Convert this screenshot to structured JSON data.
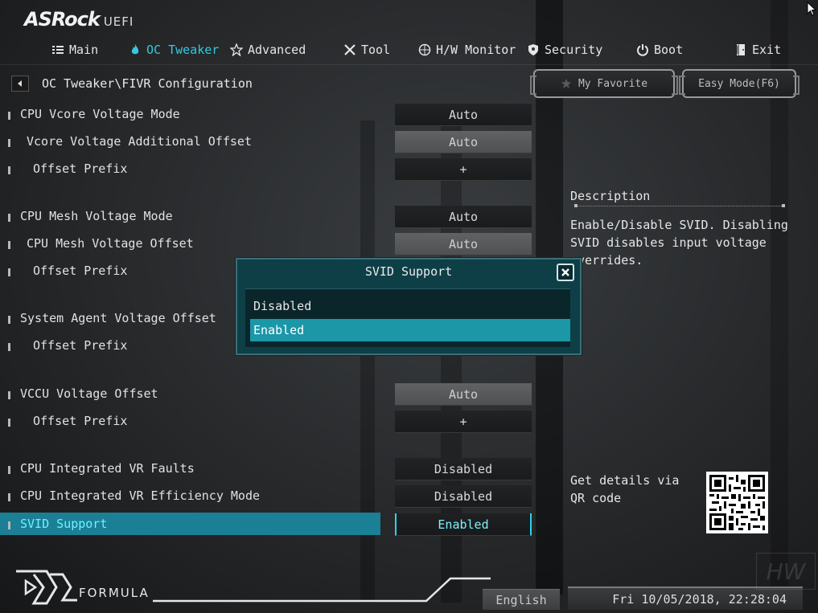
{
  "brand": {
    "name": "ASRock",
    "suffix": "UEFI"
  },
  "nav": {
    "items": [
      {
        "label": "Main",
        "icon": "list-icon",
        "active": false
      },
      {
        "label": "OC Tweaker",
        "icon": "flame-icon",
        "active": true
      },
      {
        "label": "Advanced",
        "icon": "star-icon",
        "active": false
      },
      {
        "label": "Tool",
        "icon": "tools-icon",
        "active": false
      },
      {
        "label": "H/W Monitor",
        "icon": "monitor-icon",
        "active": false
      },
      {
        "label": "Security",
        "icon": "shield-icon",
        "active": false
      },
      {
        "label": "Boot",
        "icon": "power-icon",
        "active": false
      },
      {
        "label": "Exit",
        "icon": "exit-icon",
        "active": false
      }
    ]
  },
  "breadcrumb": {
    "path": "OC Tweaker\\FIVR Configuration"
  },
  "buttons": {
    "favorite": "My Favorite",
    "easy_mode": "Easy Mode(F6)"
  },
  "settings": [
    {
      "label": "CPU Vcore Voltage Mode",
      "value": "Auto",
      "indent": 0,
      "style": "dark"
    },
    {
      "label": "Vcore Voltage Additional Offset",
      "value": "Auto",
      "indent": 1,
      "style": "grey"
    },
    {
      "label": "Offset Prefix",
      "value": "+",
      "indent": 2,
      "style": "dark"
    },
    {
      "label": "CPU Mesh Voltage Mode",
      "value": "Auto",
      "indent": 0,
      "style": "dark"
    },
    {
      "label": "CPU Mesh Voltage Offset",
      "value": "Auto",
      "indent": 1,
      "style": "grey"
    },
    {
      "label": "Offset Prefix",
      "value": "",
      "indent": 2,
      "style": "none"
    },
    {
      "label": "System Agent Voltage Offset",
      "value": "",
      "indent": 0,
      "style": "none"
    },
    {
      "label": "Offset Prefix",
      "value": "",
      "indent": 2,
      "style": "none"
    },
    {
      "label": "VCCU Voltage Offset",
      "value": "Auto",
      "indent": 0,
      "style": "grey"
    },
    {
      "label": "Offset Prefix",
      "value": "+",
      "indent": 2,
      "style": "dark"
    },
    {
      "label": "CPU Integrated VR Faults",
      "value": "Disabled",
      "indent": 0,
      "style": "dark"
    },
    {
      "label": "CPU Integrated VR Efficiency Mode",
      "value": "Disabled",
      "indent": 0,
      "style": "dark"
    },
    {
      "label": "SVID Support",
      "value": "Enabled",
      "indent": 0,
      "style": "selected"
    }
  ],
  "description": {
    "title": "Description",
    "text": "Enable/Disable SVID. Disabling SVID disables input voltage overrides."
  },
  "qr": {
    "text": "Get details via QR code"
  },
  "dialog": {
    "title": "SVID Support",
    "options": [
      {
        "label": "Disabled",
        "selected": false
      },
      {
        "label": "Enabled",
        "selected": true
      }
    ]
  },
  "footer": {
    "logo_text": "FORMULA",
    "language": "English",
    "datetime": "Fri 10/05/2018, 22:28:04"
  },
  "colors": {
    "accent": "#35c9e0",
    "selected_bg": "#1b7f96",
    "dialog_bg": "#0e3f47",
    "option_selected": "#1b97a8"
  }
}
